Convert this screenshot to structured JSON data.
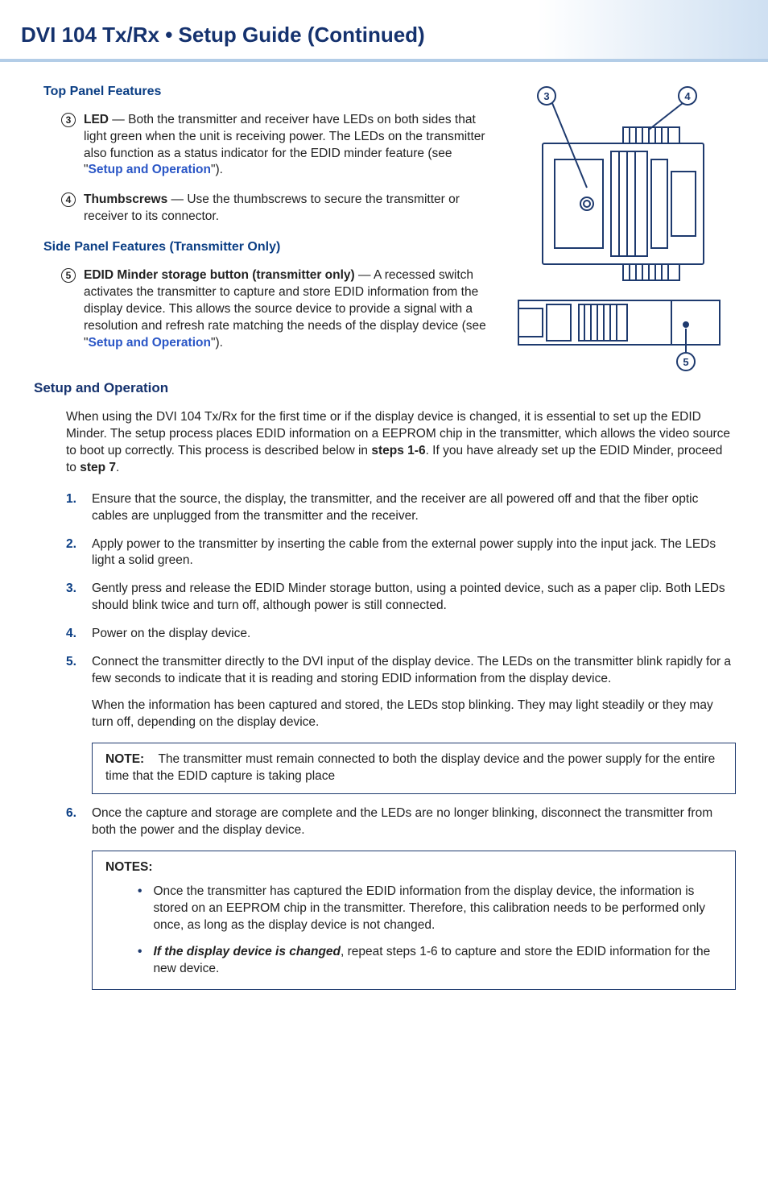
{
  "header": {
    "title": "DVI 104 Tx/Rx • Setup Guide (Continued)"
  },
  "top_panel": {
    "heading": "Top Panel Features",
    "item3": {
      "num": "3",
      "title": "LED",
      "body_a": " — Both the transmitter and receiver have LEDs on both sides that light green when the unit is receiving power. The LEDs on the transmitter also function as a status indicator for the EDID minder feature (see \"",
      "link": "Setup and Operation",
      "body_b": "\")."
    },
    "item4": {
      "num": "4",
      "title": "Thumbscrews",
      "body": " — Use the thumbscrews to secure the transmitter or receiver to its connector."
    }
  },
  "side_panel": {
    "heading": "Side Panel Features (Transmitter Only)",
    "item5": {
      "num": "5",
      "title": "EDID Minder storage button (transmitter only)",
      "body_a": " — A recessed switch activates the transmitter to capture and store EDID information from the display device. This allows the source device to provide a signal with a resolution and refresh rate matching the needs of the display device (see \"",
      "link": "Setup and Operation",
      "body_b": "\")."
    }
  },
  "setup": {
    "heading": "Setup and Operation",
    "intro_a": "When using the DVI 104 Tx/Rx for the first time or if the display device is changed, it is essential to set up the EDID Minder. The setup process places EDID information on a EEPROM chip in the transmitter, which allows the video source to boot up correctly. This process is described below in ",
    "intro_b": "steps 1-6",
    "intro_c": ". If you have already set up the EDID Minder, proceed to ",
    "intro_d": "step 7",
    "intro_e": ".",
    "steps": [
      {
        "num": "1.",
        "body": "Ensure that the source, the display, the transmitter, and the receiver are all powered off and that the fiber optic cables are unplugged from the transmitter and the receiver."
      },
      {
        "num": "2.",
        "body": "Apply power to the transmitter by inserting the cable from the external power supply into the input jack. The LEDs light a solid green."
      },
      {
        "num": "3.",
        "body": "Gently press and release the EDID Minder storage button, using a pointed device, such as a paper clip. Both LEDs should blink twice and turn off, although power is still connected."
      },
      {
        "num": "4.",
        "body": "Power on the display device."
      },
      {
        "num": "5.",
        "body": "Connect the transmitter directly to the DVI input of the display device. The LEDs on the transmitter blink rapidly for a few seconds to indicate that it is reading and storing EDID information from the display device.",
        "body2": "When the information has been captured and stored, the LEDs stop blinking. They may light steadily or they may turn off, depending on the display device."
      },
      {
        "num": "6.",
        "body": "Once the capture and storage are complete and the LEDs are no longer blinking, disconnect the transmitter from both the power and the display device."
      }
    ],
    "note1_label": "NOTE:",
    "note1_body": "The transmitter must remain connected to both the display device and the power supply for the entire time that the EDID capture is taking place",
    "notes2_label": "NOTES:",
    "notes2": [
      {
        "body": "Once the transmitter has captured the EDID information from the display device, the information is stored on an EEPROM chip in the transmitter. Therefore, this calibration needs to be performed only once, as long as the display device is not changed."
      },
      {
        "bold": "If the display device is changed",
        "body": ", repeat steps 1-6 to capture and store the EDID information for the new device."
      }
    ]
  },
  "callouts": {
    "c3": "3",
    "c4": "4",
    "c5": "5"
  }
}
